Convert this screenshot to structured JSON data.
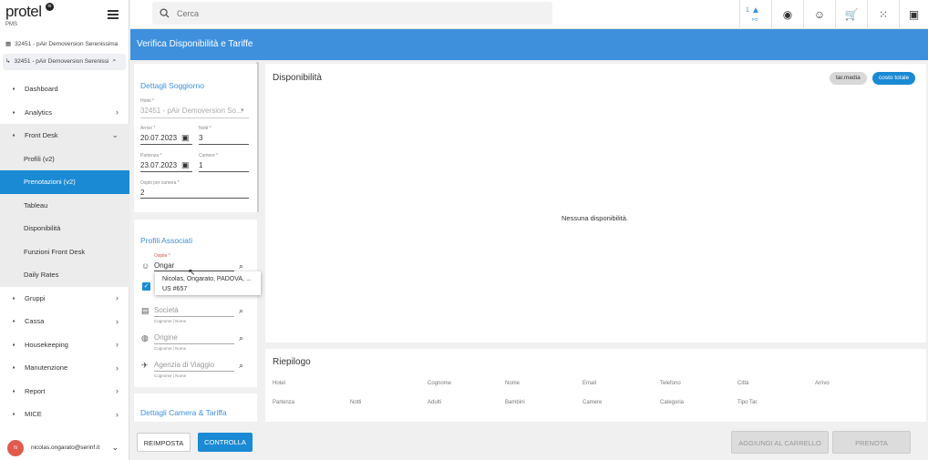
{
  "brand": {
    "name": "protel",
    "badge": "io",
    "sub": "PMS"
  },
  "context": {
    "line1": "32451 - pAir Demoversion Serenissima",
    "line2": "32451 - pAir Demoversion Serenissima"
  },
  "nav": [
    {
      "label": "Dashboard",
      "icon": "home-icon"
    },
    {
      "label": "Analytics",
      "icon": "analytics-icon",
      "chev": "›"
    },
    {
      "label": "Front Desk",
      "icon": "front-desk-icon",
      "chev": "⌄"
    },
    {
      "label": "Profili (v2)"
    },
    {
      "label": "Prenotazioni (v2)"
    },
    {
      "label": "Tableau"
    },
    {
      "label": "Disponibilità"
    },
    {
      "label": "Funzioni Front Desk"
    },
    {
      "label": "Daily Rates"
    },
    {
      "label": "Gruppi",
      "icon": "groups-icon",
      "chev": "›"
    },
    {
      "label": "Cassa",
      "icon": "cash-icon",
      "chev": "›"
    },
    {
      "label": "Housekeeping",
      "icon": "housekeeping-icon",
      "chev": "›"
    },
    {
      "label": "Manutenzione",
      "icon": "maintenance-icon",
      "chev": "›"
    },
    {
      "label": "Report",
      "icon": "report-icon",
      "chev": "›"
    },
    {
      "label": "MICE",
      "icon": "mice-icon",
      "chev": "›"
    }
  ],
  "user": {
    "initial": "N",
    "email": "nicolas.ongarato@serinf.it"
  },
  "search": {
    "placeholder": "Cerca"
  },
  "topbar": {
    "badge_count": "1",
    "badge_sub": "PO"
  },
  "header": {
    "title": "Verifica Disponibilità e Tariffe"
  },
  "stay": {
    "title": "Dettagli Soggiorno",
    "hotel_label": "Hotel *",
    "hotel_value": "32451 - pAir Demoversion So...",
    "arrival_label": "Arrivo *",
    "arrival_value": "20.07.2023",
    "nights_label": "Notti *",
    "nights_value": "3",
    "departure_label": "Partenza *",
    "departure_value": "23.07.2023",
    "rooms_label": "Camere *",
    "rooms_value": "1",
    "guests_label": "Ospiti per camera *",
    "guests_value": "2"
  },
  "profiles": {
    "title": "Profili Associati",
    "guest_label": "Ospite *",
    "guest_value": "Ongar",
    "company_placeholder": "Società",
    "origin_placeholder": "Origine",
    "agency_placeholder": "Agenzia di Viaggio",
    "hint": "Cognome | Nome"
  },
  "dropdown": {
    "line1": "Nicolas, Ongarato, PADOVA, ...",
    "line2": "US #657"
  },
  "room": {
    "title": "Dettagli Camera & Tariffa"
  },
  "availability": {
    "title": "Disponibilità",
    "empty": "Nessuna disponibilità.",
    "pill1": "tar.media",
    "pill2": "costo totale"
  },
  "summary": {
    "title": "Riepilogo",
    "row1": [
      "Hotel",
      "Cognome",
      "Nome",
      "Email",
      "Telefono",
      "Città",
      "Arrivo"
    ],
    "row2": [
      "Partenza",
      "Notti",
      "Adulti",
      "Bambini",
      "Camere",
      "Categoria",
      "Tipo Tar."
    ]
  },
  "buttons": {
    "reset": "REIMPOSTA",
    "check": "CONTROLLA",
    "cart": "AGGIUNGI AL CARRELLO",
    "book": "PRENOTA"
  },
  "colors": {
    "accent": "#3e90dd",
    "active": "#1a8ad4"
  }
}
